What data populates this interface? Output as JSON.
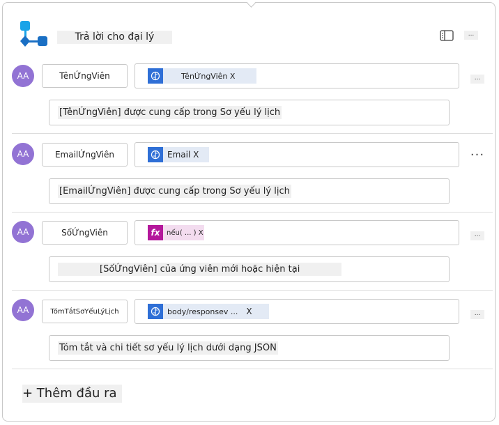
{
  "header": {
    "title": "Trả lời cho đại lý",
    "more_label": "..."
  },
  "outputs": [
    {
      "avatar": "AA",
      "name": "TênỨngViên",
      "token_type": "variable",
      "token_label": "TênỨngViên X",
      "description": "[TênỨngViên] được cung cấp trong Sơ yếu lý lịch",
      "more_label": "..."
    },
    {
      "avatar": "AA",
      "name": "EmailỨngViên",
      "token_type": "variable",
      "token_label": "Email X",
      "description": "[EmailỨngViên] được cung cấp trong Sơ yếu lý lịch",
      "more_label": "···"
    },
    {
      "avatar": "AA",
      "name": "SốỨngViên",
      "token_type": "expression",
      "token_icon_label": "fx",
      "token_label": "nếu( ... ) X",
      "description": "[SốỨngViên] của ứng viên mới hoặc hiện tại",
      "more_label": "..."
    },
    {
      "avatar": "AA",
      "name": "TómTắtSơYếuLýLịch",
      "token_type": "variable",
      "token_label": "body/responsev ...",
      "token_close": "X",
      "description": "Tóm tắt và chi tiết sơ yếu lý lịch dưới dạng JSON",
      "more_label": "..."
    }
  ],
  "footer": {
    "add_output_label": "+ Thêm đầu ra"
  },
  "colors": {
    "avatar": "#9273d4",
    "variable_icon": "#2f6fd6",
    "expression_icon": "#b4179b",
    "token_bg": "#e3eaf5"
  },
  "icons": {
    "header": "agent-flow-icon",
    "panel": "side-panel-icon",
    "variable": "brain-circuit-icon"
  }
}
